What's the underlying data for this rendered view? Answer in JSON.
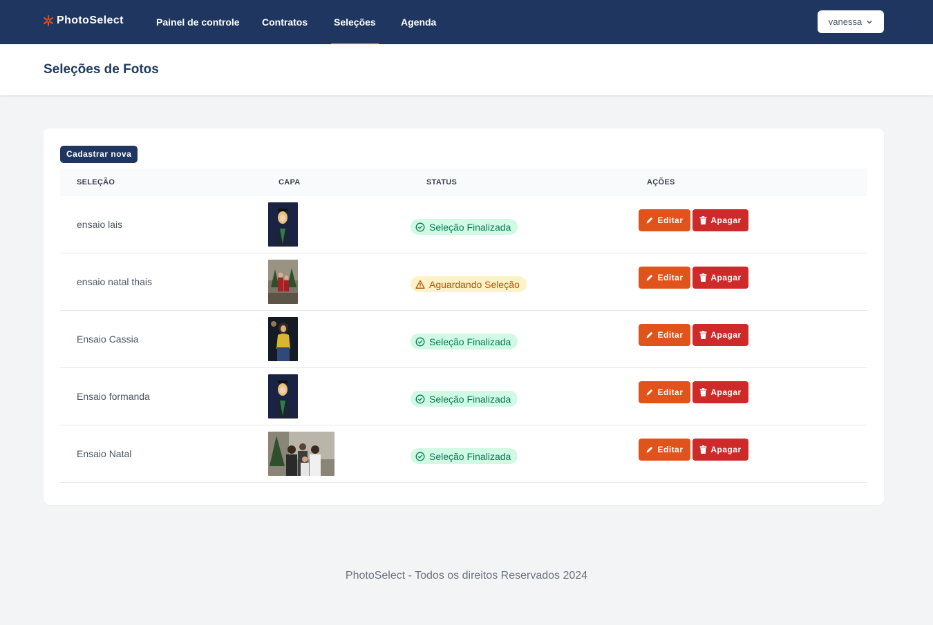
{
  "brand": {
    "name": "PhotoSelect",
    "accent": "#e8501f"
  },
  "nav": {
    "items": [
      {
        "label": "Painel de controle",
        "active": false
      },
      {
        "label": "Contratos",
        "active": false
      },
      {
        "label": "Seleções",
        "active": true
      },
      {
        "label": "Agenda",
        "active": false
      }
    ],
    "user": {
      "name": "vanessa",
      "icon": "chevron-down-icon"
    }
  },
  "page": {
    "title": "Seleções de Fotos"
  },
  "toolbar": {
    "new_label": "Cadastrar nova"
  },
  "table": {
    "columns": [
      "SELEÇÃO",
      "CAPA",
      "STATUS",
      "AÇÕES"
    ],
    "rows": [
      {
        "name": "ensaio lais",
        "status": "Seleção Finalizada",
        "status_type": "done",
        "edit_label": "Editar",
        "delete_label": "Apagar"
      },
      {
        "name": "ensaio natal thais",
        "status": "Aguardando Seleção",
        "status_type": "wait",
        "edit_label": "Editar",
        "delete_label": "Apagar"
      },
      {
        "name": "Ensaio Cassia",
        "status": "Seleção Finalizada",
        "status_type": "done",
        "edit_label": "Editar",
        "delete_label": "Apagar"
      },
      {
        "name": "Ensaio formanda",
        "status": "Seleção Finalizada",
        "status_type": "done",
        "edit_label": "Editar",
        "delete_label": "Apagar"
      },
      {
        "name": "Ensaio Natal",
        "status": "Seleção Finalizada",
        "status_type": "done",
        "edit_label": "Editar",
        "delete_label": "Apagar"
      }
    ]
  },
  "colors": {
    "navbar": "#1f3760",
    "edit_button": "#e0531a",
    "delete_button": "#cf2a2a",
    "status_done_bg": "#d1fae5",
    "status_wait_bg": "#fef3c7"
  },
  "footer": {
    "text": "PhotoSelect - Todos os direitos Reservados 2024"
  }
}
